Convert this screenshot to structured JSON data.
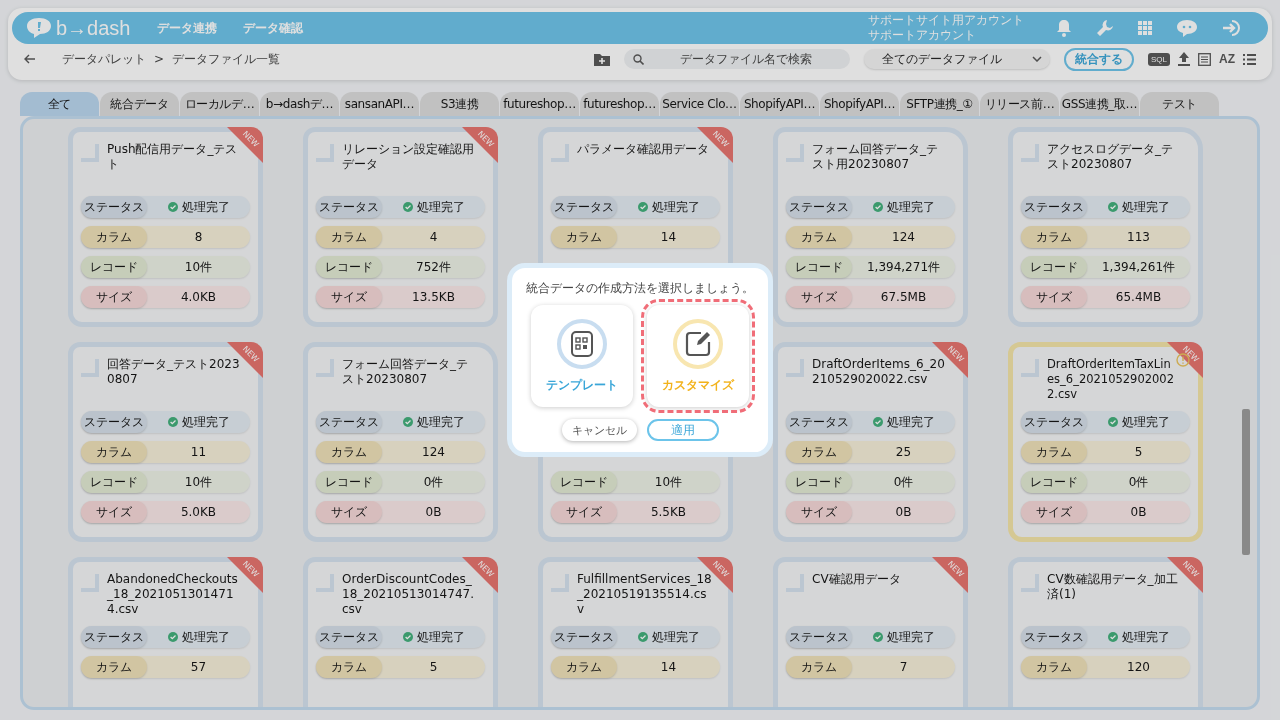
{
  "header": {
    "logo": "b→dash",
    "nav": [
      {
        "label": "データ連携"
      },
      {
        "label": "データ確認"
      }
    ],
    "account": [
      "サポートサイト用アカウント",
      "サポートアカウント"
    ]
  },
  "toolbar": {
    "breadcrumb": [
      "データパレット",
      "データファイル一覧"
    ],
    "separator": ">",
    "search": {
      "placeholder": "データファイル名で検索"
    },
    "filter": "全てのデータファイル",
    "merge_button": "統合する",
    "sql_label": "SQL",
    "sort_label": "AZ"
  },
  "tabs": [
    {
      "label": "全て",
      "selected": true
    },
    {
      "label": "統合データ",
      "selected": false
    },
    {
      "label": "ローカルデ…",
      "selected": false
    },
    {
      "label": "b→dashデ…",
      "selected": false
    },
    {
      "label": "sansanAPI…",
      "selected": false
    },
    {
      "label": "S3連携",
      "selected": false
    },
    {
      "label": "futureshop…",
      "selected": false
    },
    {
      "label": "futureshop…",
      "selected": false
    },
    {
      "label": "Service Clo…",
      "selected": false
    },
    {
      "label": "ShopifyAPI…",
      "selected": false
    },
    {
      "label": "ShopifyAPI…",
      "selected": false
    },
    {
      "label": "SFTP連携_①",
      "selected": false
    },
    {
      "label": "リリース前…",
      "selected": false
    },
    {
      "label": "GSS連携_取…",
      "selected": false
    },
    {
      "label": "テスト",
      "selected": false
    }
  ],
  "cards": [
    {
      "name": "Push配信用データ_テスト",
      "badge": "NEW",
      "warning": false,
      "rows": [
        {
          "kind": "status",
          "label": "ステータス",
          "value": "処理完了"
        },
        {
          "kind": "columns",
          "label": "カラム",
          "value": "8"
        },
        {
          "kind": "records",
          "label": "レコード",
          "value": "10件"
        },
        {
          "kind": "size",
          "label": "サイズ",
          "value": "4.0KB"
        }
      ]
    },
    {
      "name": "リレーション設定確認用データ",
      "badge": "NEW",
      "warning": false,
      "rows": [
        {
          "kind": "status",
          "label": "ステータス",
          "value": "処理完了"
        },
        {
          "kind": "columns",
          "label": "カラム",
          "value": "4"
        },
        {
          "kind": "records",
          "label": "レコード",
          "value": "752件"
        },
        {
          "kind": "size",
          "label": "サイズ",
          "value": "13.5KB"
        }
      ]
    },
    {
      "name": "パラメータ確認用データ",
      "badge": "NEW",
      "warning": false,
      "rows": [
        {
          "kind": "status",
          "label": "ステータス",
          "value": "処理完了"
        },
        {
          "kind": "columns",
          "label": "カラム",
          "value": "14"
        }
      ]
    },
    {
      "name": "フォーム回答データ_テスト用20230807",
      "warning": false,
      "rows": [
        {
          "kind": "status",
          "label": "ステータス",
          "value": "処理完了"
        },
        {
          "kind": "columns",
          "label": "カラム",
          "value": "124"
        },
        {
          "kind": "records",
          "label": "レコード",
          "value": "1,394,271件"
        },
        {
          "kind": "size",
          "label": "サイズ",
          "value": "67.5MB"
        }
      ]
    },
    {
      "name": "アクセスログデータ_テスト20230807",
      "warning": false,
      "rows": [
        {
          "kind": "status",
          "label": "ステータス",
          "value": "処理完了"
        },
        {
          "kind": "columns",
          "label": "カラム",
          "value": "113"
        },
        {
          "kind": "records",
          "label": "レコード",
          "value": "1,394,261件"
        },
        {
          "kind": "size",
          "label": "サイズ",
          "value": "65.4MB"
        }
      ]
    },
    {
      "name": "回答データ_テスト20230807",
      "badge": "NEW",
      "warning": false,
      "rows": [
        {
          "kind": "status",
          "label": "ステータス",
          "value": "処理完了"
        },
        {
          "kind": "columns",
          "label": "カラム",
          "value": "11"
        },
        {
          "kind": "records",
          "label": "レコード",
          "value": "10件"
        },
        {
          "kind": "size",
          "label": "サイズ",
          "value": "5.0KB"
        }
      ]
    },
    {
      "name": "フォーム回答データ_テスト20230807",
      "warning": false,
      "rows": [
        {
          "kind": "status",
          "label": "ステータス",
          "value": "処理完了"
        },
        {
          "kind": "columns",
          "label": "カラム",
          "value": "124"
        },
        {
          "kind": "records",
          "label": "レコード",
          "value": "0件"
        },
        {
          "kind": "size",
          "label": "サイズ",
          "value": "0B"
        }
      ]
    },
    {
      "warning": false,
      "rows": [
        {
          "kind": "records",
          "label": "レコード",
          "value": "10件"
        },
        {
          "kind": "size",
          "label": "サイズ",
          "value": "5.5KB"
        }
      ]
    },
    {
      "name": "DraftOrderItems_6_20210529020022.csv",
      "badge": "NEW",
      "warning": false,
      "rows": [
        {
          "kind": "status",
          "label": "ステータス",
          "value": "処理完了"
        },
        {
          "kind": "columns",
          "label": "カラム",
          "value": "25"
        },
        {
          "kind": "records",
          "label": "レコード",
          "value": "0件"
        },
        {
          "kind": "size",
          "label": "サイズ",
          "value": "0B"
        }
      ]
    },
    {
      "name": "DraftOrderItemTaxLines_6_20210529020022.csv",
      "badge": "NEW",
      "warning": true,
      "rows": [
        {
          "kind": "status",
          "label": "ステータス",
          "value": "処理完了"
        },
        {
          "kind": "columns",
          "label": "カラム",
          "value": "5"
        },
        {
          "kind": "records",
          "label": "レコード",
          "value": "0件"
        },
        {
          "kind": "size",
          "label": "サイズ",
          "value": "0B"
        }
      ]
    },
    {
      "name": "AbandonedCheckouts_18_20210513014714.csv",
      "badge": "NEW",
      "warning": false,
      "rows": [
        {
          "kind": "status",
          "label": "ステータス",
          "value": "処理完了"
        },
        {
          "kind": "columns",
          "label": "カラム",
          "value": "57"
        }
      ]
    },
    {
      "name": "OrderDiscountCodes_18_20210513014747.csv",
      "badge": "NEW",
      "warning": false,
      "rows": [
        {
          "kind": "status",
          "label": "ステータス",
          "value": "処理完了"
        },
        {
          "kind": "columns",
          "label": "カラム",
          "value": "5"
        }
      ]
    },
    {
      "name": "FulfillmentServices_18_20210519135514.csv",
      "badge": "NEW",
      "warning": false,
      "rows": [
        {
          "kind": "status",
          "label": "ステータス",
          "value": "処理完了"
        },
        {
          "kind": "columns",
          "label": "カラム",
          "value": "14"
        }
      ]
    },
    {
      "name": "CV確認用データ",
      "badge": "NEW",
      "warning": false,
      "rows": [
        {
          "kind": "status",
          "label": "ステータス",
          "value": "処理完了"
        },
        {
          "kind": "columns",
          "label": "カラム",
          "value": "7"
        }
      ]
    },
    {
      "name": "CV数確認用データ_加工済(1)",
      "badge": "NEW",
      "warning": false,
      "rows": [
        {
          "kind": "status",
          "label": "ステータス",
          "value": "処理完了"
        },
        {
          "kind": "columns",
          "label": "カラム",
          "value": "120"
        }
      ]
    }
  ],
  "dialog": {
    "title": "統合データの作成方法を選択しましょう。",
    "options": [
      {
        "kind": "template",
        "label": "テンプレート",
        "selected": false
      },
      {
        "kind": "custom",
        "label": "カスタマイズ",
        "selected": true
      }
    ],
    "buttons": [
      {
        "kind": "secondary",
        "label": "キャンセル"
      },
      {
        "kind": "primary",
        "label": "適用"
      }
    ]
  }
}
